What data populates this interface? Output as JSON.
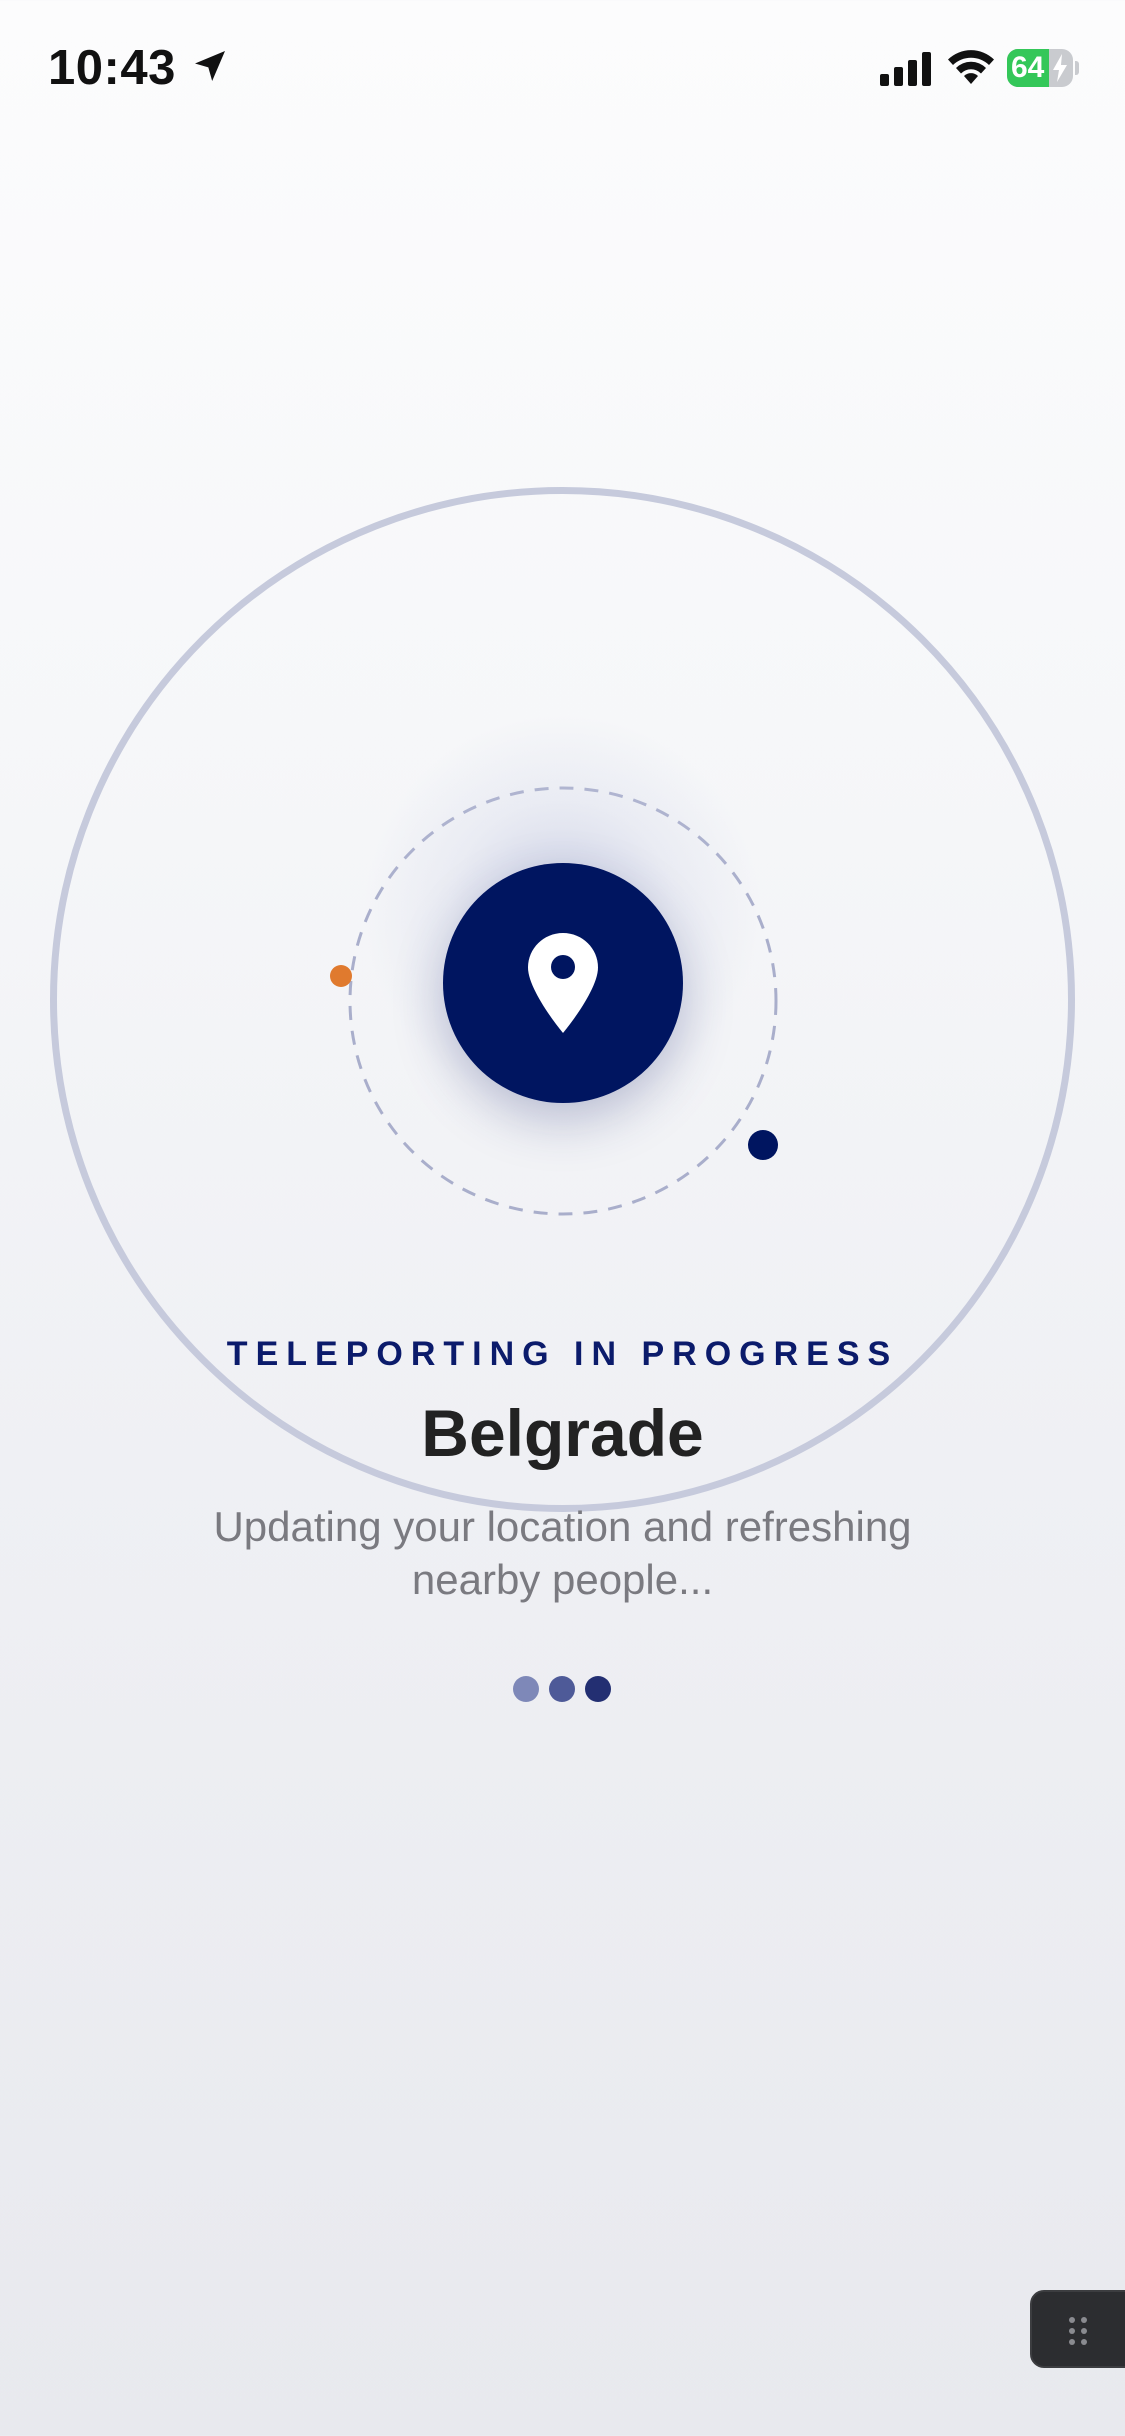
{
  "status_bar": {
    "time": "10:43",
    "battery_percent": "64",
    "battery_level": 0.64,
    "location_icon": "location-arrow-icon",
    "signal_icon": "cellular-signal-icon",
    "wifi_icon": "wifi-icon",
    "battery_icon": "battery-charging-icon"
  },
  "main": {
    "status_label": "TELEPORTING IN PROGRESS",
    "city": "Belgrade",
    "subtitle": "Updating your location and refreshing nearby people...",
    "center_icon": "map-pin-icon",
    "loading_dots_count": 3
  },
  "floating_handle": {
    "icon": "drag-grip-icon"
  },
  "colors": {
    "accent": "#001560",
    "orange_dot": "#e07a2e",
    "ring": "#c6cadc",
    "label_text": "#0b1b6b",
    "title_text": "#222222",
    "subtitle_text": "#7a7a80",
    "battery_green": "#34c759"
  }
}
